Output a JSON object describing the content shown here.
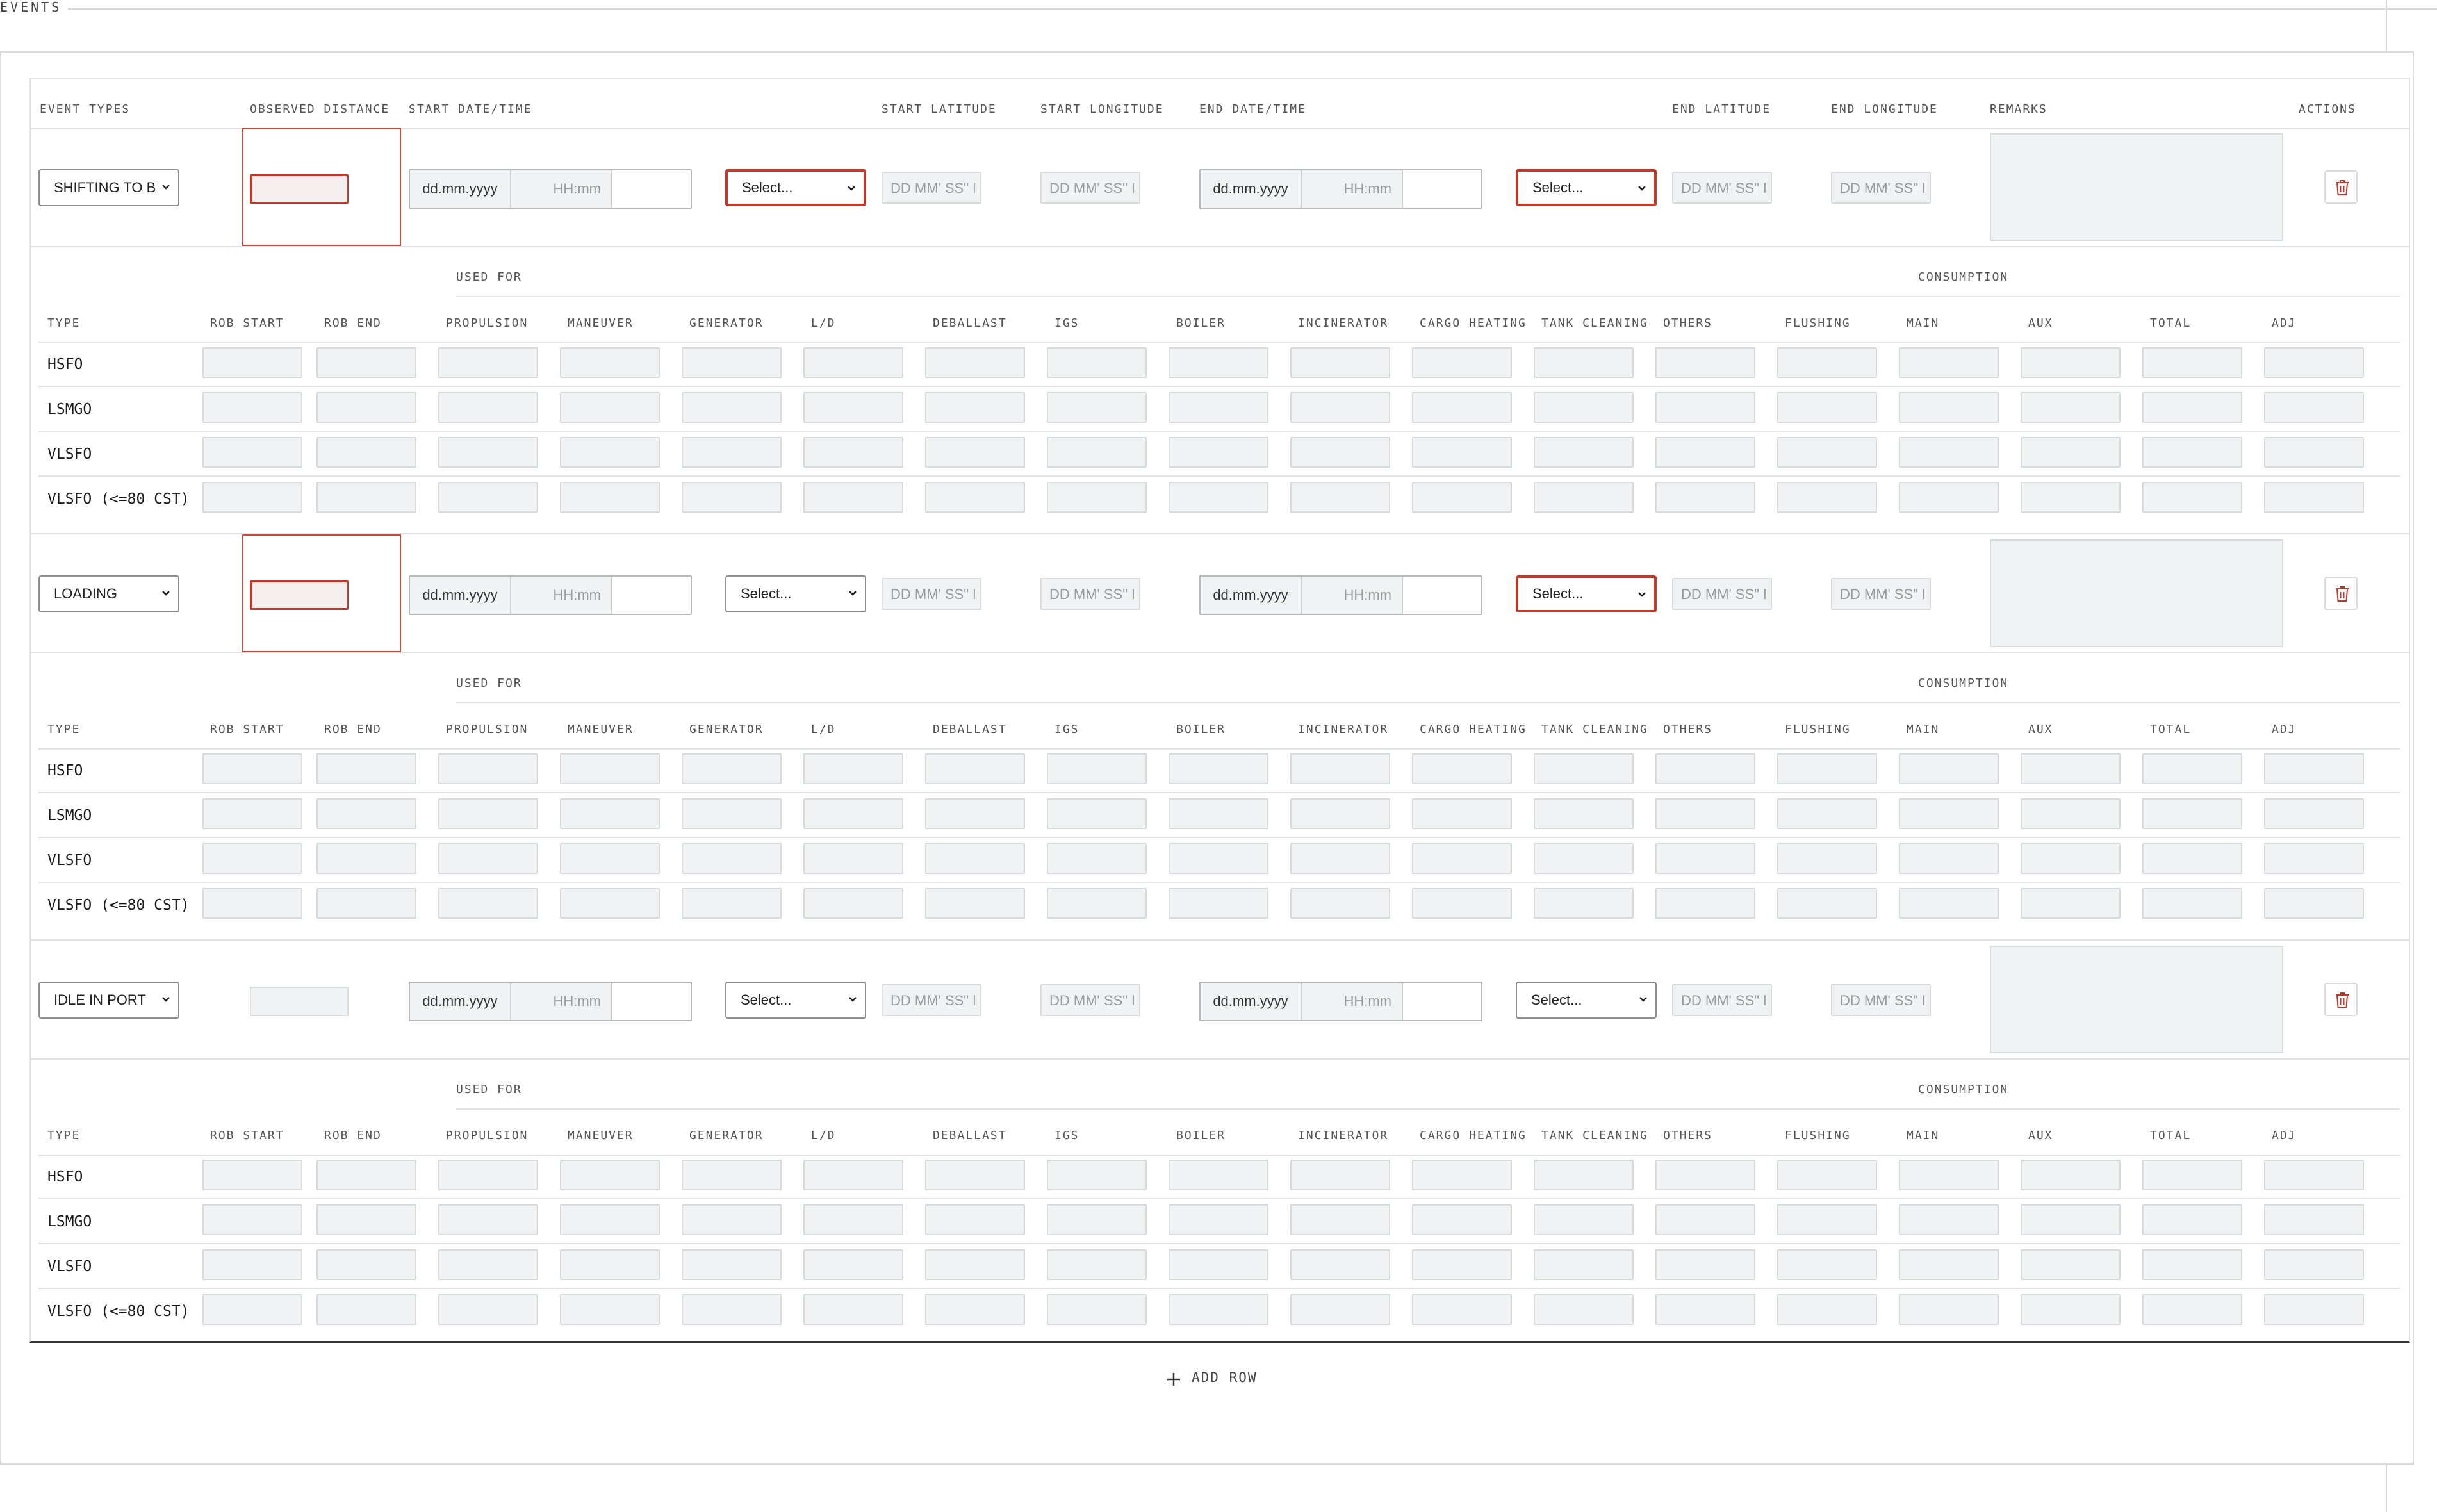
{
  "section": {
    "title": "EVENTS"
  },
  "headers": {
    "event_types": "EVENT TYPES",
    "observed_distance": "OBSERVED DISTANCE",
    "start_datetime": "START DATE/TIME",
    "start_latitude": "START LATITUDE",
    "start_longitude": "START LONGITUDE",
    "end_datetime": "END DATE/TIME",
    "end_latitude": "END LATITUDE",
    "end_longitude": "END LONGITUDE",
    "remarks": "REMARKS",
    "actions": "ACTIONS"
  },
  "placeholders": {
    "date": "dd.mm.yyyy",
    "time": "HH:mm",
    "select": "Select...",
    "latitude": "DD MM' SS\" N",
    "longitude": "DD MM' SS\" E"
  },
  "fuel_headers": {
    "used_for": "USED FOR",
    "consumption": "CONSUMPTION",
    "columns": [
      "TYPE",
      "ROB START",
      "ROB END",
      "PROPULSION",
      "MANEUVER",
      "GENERATOR",
      "L/D",
      "DEBALLAST",
      "IGS",
      "BOILER",
      "INCINERATOR",
      "CARGO HEATING",
      "TANK CLEANING",
      "OTHERS",
      "FLUSHING",
      "MAIN",
      "AUX",
      "TOTAL",
      "ADJ"
    ]
  },
  "fuel_types": [
    "HSFO",
    "LSMGO",
    "VLSFO",
    "VLSFO (<=80 CST)"
  ],
  "events": [
    {
      "type": "SHIFTING TO B",
      "distance_error": true,
      "start_select_error": true,
      "end_select_error": true
    },
    {
      "type": "LOADING",
      "distance_error": true,
      "start_select_error": false,
      "end_select_error": true
    },
    {
      "type": "IDLE IN PORT",
      "distance_error": false,
      "start_select_error": false,
      "end_select_error": false
    }
  ],
  "actions": {
    "add_row": "ADD ROW"
  },
  "icons": {
    "delete": "trash-icon",
    "add": "plus-icon",
    "dropdown": "chevron-down-icon"
  },
  "colors": {
    "error": "#c0392b",
    "delete": "#c0392b"
  }
}
